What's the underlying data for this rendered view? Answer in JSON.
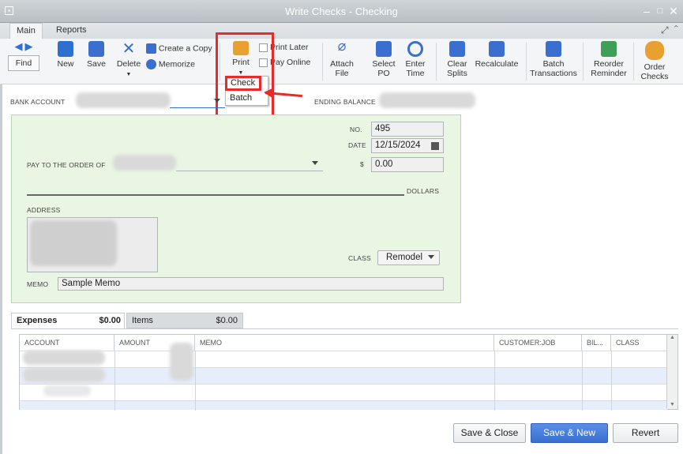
{
  "window": {
    "title": "Write Checks - Checking"
  },
  "tabs": [
    {
      "label": "Main"
    },
    {
      "label": "Reports"
    }
  ],
  "toolbar": {
    "find": "Find",
    "new": "New",
    "save": "Save",
    "delete": "Delete",
    "create_copy": "Create a Copy",
    "memorize": "Memorize",
    "print": "Print",
    "print_later": "Print Later",
    "pay_online": "Pay Online",
    "attach_file": [
      "Attach",
      "File"
    ],
    "select_po": [
      "Select",
      "PO"
    ],
    "enter_time": [
      "Enter",
      "Time"
    ],
    "clear_splits": [
      "Clear",
      "Splits"
    ],
    "recalculate": "Recalculate",
    "batch_transactions": [
      "Batch",
      "Transactions"
    ],
    "reorder_reminder": [
      "Reorder",
      "Reminder"
    ],
    "order_checks": [
      "Order",
      "Checks"
    ]
  },
  "print_menu": {
    "items": [
      "Check",
      "Batch"
    ]
  },
  "header": {
    "bank_account_label": "BANK ACCOUNT",
    "ending_balance_label": "ENDING BALANCE"
  },
  "check": {
    "no_label": "NO.",
    "no_value": "495",
    "date_label": "DATE",
    "date_value": "12/15/2024",
    "pay_to_label": "PAY TO THE ORDER OF",
    "amount_symbol": "$",
    "amount_value": "0.00",
    "dollars_label": "DOLLARS",
    "address_label": "ADDRESS",
    "class_label": "CLASS",
    "class_value": "Remodel",
    "memo_label": "MEMO",
    "memo_value": "Sample Memo"
  },
  "detail_tabs": [
    {
      "label": "Expenses",
      "amount": "$0.00"
    },
    {
      "label": "Items",
      "amount": "$0.00"
    }
  ],
  "grid": {
    "columns": [
      "ACCOUNT",
      "AMOUNT",
      "MEMO",
      "CUSTOMER:JOB",
      "BIL...",
      "CLASS"
    ]
  },
  "buttons": {
    "save_close": "Save & Close",
    "save_new": "Save & New",
    "revert": "Revert"
  },
  "colors": {
    "annotation": "#e82a2a",
    "check_bg": "#e8f6e3",
    "primary_button": "#3a6fd0"
  }
}
